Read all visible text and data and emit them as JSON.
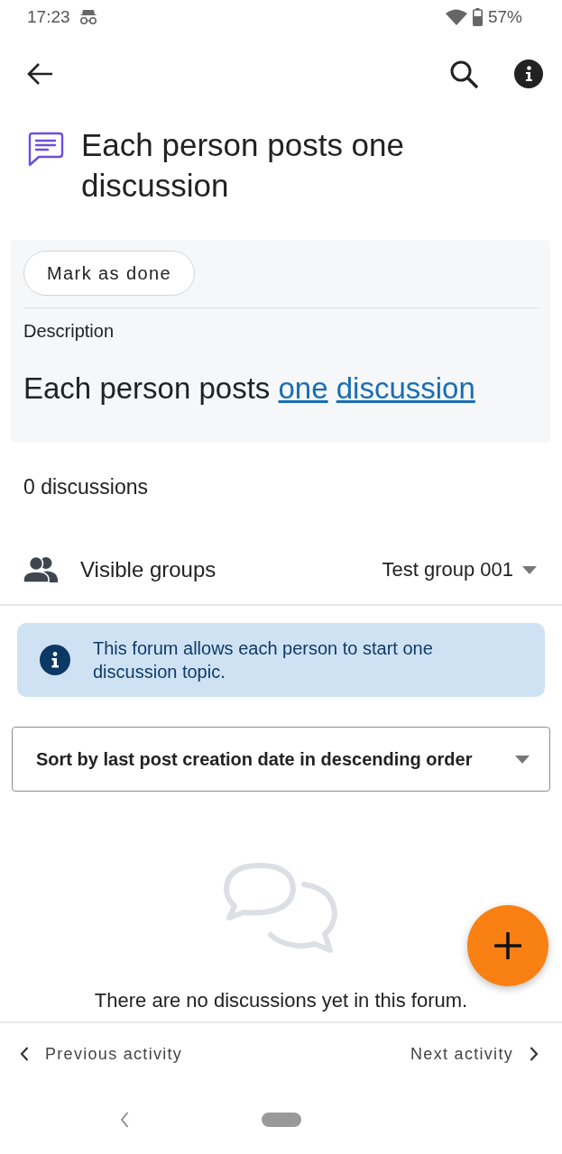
{
  "status_bar": {
    "time": "17:23",
    "battery": "57%"
  },
  "title": "Each person posts one discussion",
  "card": {
    "mark_done_button": "Mark as done",
    "description_label": "Description",
    "description_parts": [
      {
        "kind": "text",
        "text": "Each person posts"
      },
      {
        "kind": "link",
        "text": "one"
      },
      {
        "kind": "link",
        "text": "discussion"
      }
    ]
  },
  "discussion_count": "0 discussions",
  "groups": {
    "label": "Visible groups",
    "value": "Test group 001"
  },
  "alert": {
    "text": "This forum allows each person to start one discussion topic."
  },
  "sort": {
    "value": "Sort by last post creation date in descending order"
  },
  "empty_state": {
    "message": "There are no discussions yet in this forum."
  },
  "footer": {
    "previous": "Previous activity",
    "next": "Next activity"
  }
}
